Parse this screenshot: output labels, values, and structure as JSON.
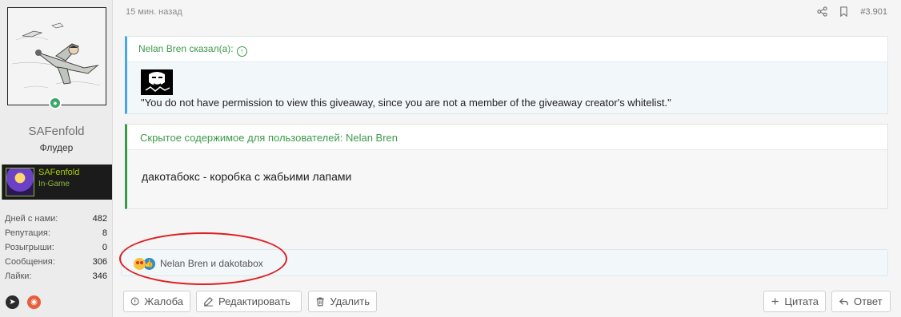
{
  "user": {
    "name": "SAFenfold",
    "title": "Флудер",
    "steam": {
      "name": "SAFenfold",
      "status": "In-Game"
    },
    "stats": [
      {
        "label": "Дней с нами:",
        "value": "482"
      },
      {
        "label": "Репутация:",
        "value": "8"
      },
      {
        "label": "Розыгрыши:",
        "value": "0"
      },
      {
        "label": "Сообщения:",
        "value": "306"
      },
      {
        "label": "Лайки:",
        "value": "346"
      }
    ],
    "social": [
      {
        "icon": "telegram-icon"
      },
      {
        "icon": "lolz-icon"
      }
    ]
  },
  "post": {
    "time": "15 мин. назад",
    "number": "#3.901",
    "quote": {
      "author": "Nelan Bren сказал(а):",
      "text": "\"You do not have permission to view this giveaway, since you are not a member of the giveaway creator's whitelist.\""
    },
    "hidden": {
      "header": "Скрытое содержимое для пользователей: Nelan Bren",
      "text": "дакотабокс - коробка с жабьими лапами"
    },
    "reactions": {
      "text": "Nelan Bren и dakotabox"
    },
    "buttons": {
      "report": "Жалоба",
      "edit": "Редактировать",
      "delete": "Удалить",
      "quote": "Цитата",
      "reply": "Ответ"
    }
  },
  "colors": {
    "accent_green": "#3d9a4a",
    "quote_border": "#47a7eb",
    "highlight": "#dd1f23"
  }
}
